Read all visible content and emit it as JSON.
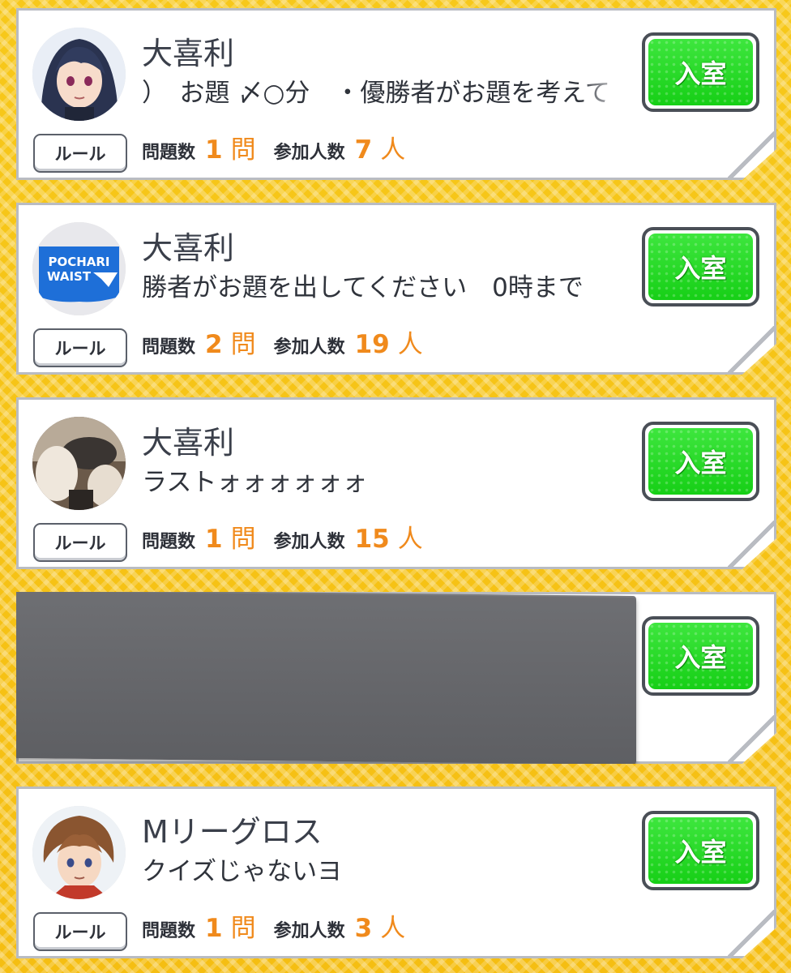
{
  "common": {
    "rule_label": "ルール",
    "enter_label": "入室",
    "questions_label": "問題数",
    "question_unit": "問",
    "participants_label": "参加人数",
    "participant_unit": "人"
  },
  "rooms": [
    {
      "title": "大喜利",
      "description": "）　お題 〆○分　・優勝者がお題を考えて",
      "questions": "1",
      "participants": "7",
      "avatar": "anime-girl-avatar"
    },
    {
      "title": "大喜利",
      "description": "勝者がお題を出してください　0時まで",
      "questions": "2",
      "participants": "19",
      "avatar": "pochari-waist-avatar",
      "avatar_text_1": "POCHARI",
      "avatar_text_2": "WAIST"
    },
    {
      "title": "大喜利",
      "description": "ラストォォォォォォ",
      "questions": "1",
      "participants": "15",
      "avatar": "car-airbag-photo-avatar"
    },
    {
      "redacted": true
    },
    {
      "title": "Mリーグロス",
      "description": "クイズじゃないヨ",
      "questions": "1",
      "participants": "3",
      "avatar": "anime-boy-avatar"
    }
  ],
  "colors": {
    "accent_orange": "#f08a1c",
    "enter_green": "#22d822",
    "background_yellow": "#f5c215"
  }
}
